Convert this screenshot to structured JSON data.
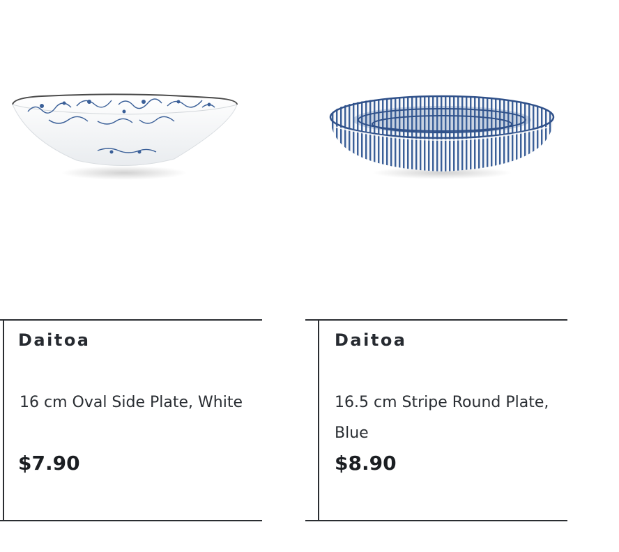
{
  "products": [
    {
      "image_alt": "Oval white plate with blue floral pattern",
      "brand": "Daitoa",
      "title": "16 cm Oval Side Plate, White",
      "price": "$7.90"
    },
    {
      "image_alt": "Round plate with blue radial stripes",
      "brand": "Daitoa",
      "title": "16.5 cm Stripe Round Plate, Blue",
      "price": "$8.90"
    }
  ],
  "colors": {
    "text": "#1f2328",
    "border": "#2a2d31",
    "plate_blue": "#3a5f98",
    "plate_white": "#f7f8fa"
  }
}
